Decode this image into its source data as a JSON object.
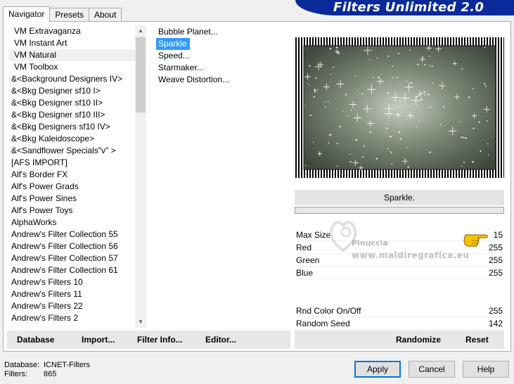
{
  "tabs": [
    "Navigator",
    "Presets",
    "About"
  ],
  "banner": "Filters Unlimited 2.0",
  "categories": [
    "VM Extravaganza",
    "VM Instant Art",
    "VM Natural",
    "VM Toolbox",
    "&<Background Designers IV>",
    "&<Bkg Designer sf10 I>",
    "&<Bkg Designer sf10 II>",
    "&<Bkg Designer sf10 III>",
    "&<Bkg Designers sf10 IV>",
    "&<Bkg Kaleidoscope>",
    "&<Sandflower Specials\"v\" >",
    "[AFS IMPORT]",
    "Alf's Border FX",
    "Alf's Power Grads",
    "Alf's Power Sines",
    "Alf's Power Toys",
    "AlphaWorks",
    "Andrew's Filter Collection 55",
    "Andrew's Filter Collection 56",
    "Andrew's Filter Collection 57",
    "Andrew's Filter Collection 61",
    "Andrew's Filters 10",
    "Andrew's Filters 11",
    "Andrew's Filters 22",
    "Andrew's Filters 2"
  ],
  "filters": [
    "Bubble Planet...",
    "Sparkle",
    "Speed...",
    "Starmaker...",
    "Weave Distortion..."
  ],
  "left_bar": {
    "database": "Database",
    "import": "Import...",
    "filter_info": "Filter Info...",
    "editor": "Editor..."
  },
  "filter_name": "Sparkle.",
  "params": {
    "max_size": {
      "label": "Max Size",
      "value": "15"
    },
    "red": {
      "label": "Red",
      "value": "255"
    },
    "green": {
      "label": "Green",
      "value": "255"
    },
    "blue": {
      "label": "Blue",
      "value": "255"
    },
    "rnd_color": {
      "label": "Rnd Color On/Off",
      "value": "255"
    },
    "rnd_seed": {
      "label": "Random Seed",
      "value": "142"
    }
  },
  "right_bar": {
    "randomize": "Randomize",
    "reset": "Reset"
  },
  "watermark": {
    "line1": "Pinuccia",
    "line2": "www.maldiregrafica.eu"
  },
  "footer": {
    "database_label": "Database:",
    "database_value": "ICNET-Filters",
    "filters_label": "Filters:",
    "filters_value": "865"
  },
  "buttons": {
    "apply": "Apply",
    "cancel": "Cancel",
    "help": "Help"
  },
  "colors": {
    "selection": "#3399ff",
    "banner": "#0a2a9a",
    "preview_center": "#c5cdbf",
    "preview_edge": "#3e483c"
  }
}
